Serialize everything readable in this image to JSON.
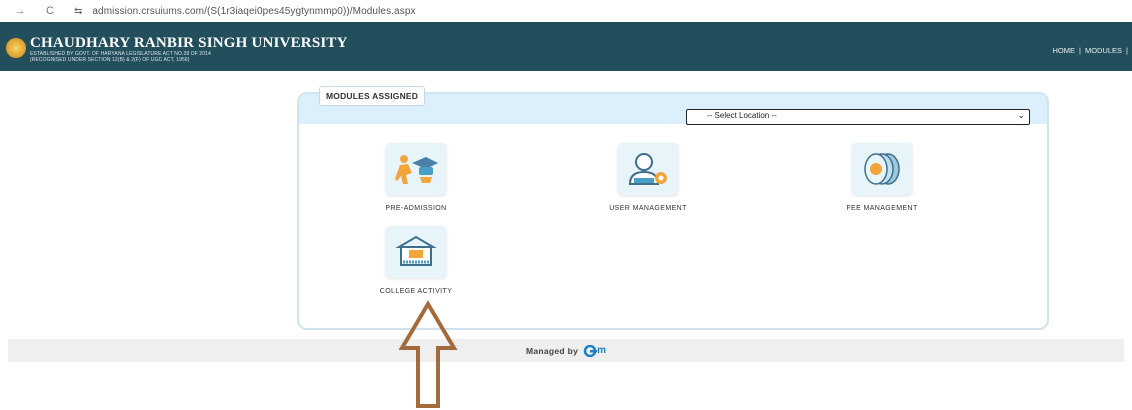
{
  "browser": {
    "back_icon": "→",
    "reload_icon": "C",
    "site_icon": "⇆",
    "url": "admission.crsuiums.com/(S(1r3iaqei0pes45ygtynmmp0))/Modules.aspx"
  },
  "header": {
    "university_name": "CHAUDHARY RANBIR SINGH UNIVERSITY",
    "subtitle_line1": "ESTABLISHED BY GOVT. OF HARYANA LEGISLATURE ACT NO.28 OF 2014",
    "subtitle_line2": "(RECOGNISED UNDER SECTION 12(B) & 2(F) OF UGC ACT, 1956)",
    "nav": {
      "home": "HOME",
      "sep1": "|",
      "modules": "MODULES",
      "sep2": "|"
    }
  },
  "panel": {
    "title": "MODULES ASSIGNED",
    "location_select": {
      "selected": "-- Select Location --"
    },
    "modules": [
      {
        "label": "PRE-ADMISSION",
        "icon": "graduate-cap-icon"
      },
      {
        "label": "USER MANAGEMENT",
        "icon": "user-settings-icon"
      },
      {
        "label": "FEE MANAGEMENT",
        "icon": "coins-icon"
      },
      {
        "label": "COLLEGE ACTIVITY",
        "icon": "college-building-icon"
      }
    ]
  },
  "footer": {
    "managed_by": "Managed by",
    "brand": "m"
  },
  "colors": {
    "header_bg": "#234f5c",
    "panel_head": "#dbf0fa",
    "arrow": "#a36b3c",
    "icon_orange": "#f3a53a",
    "icon_blue": "#4a9fc9"
  }
}
